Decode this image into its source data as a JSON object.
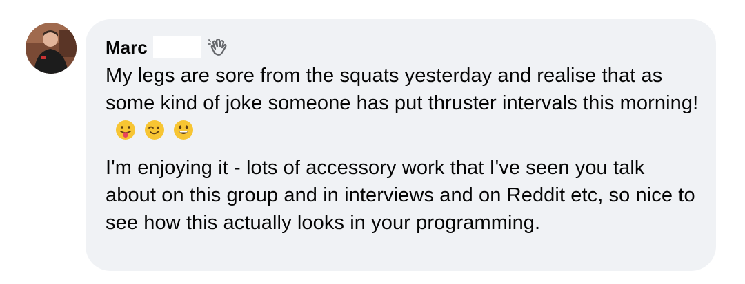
{
  "comment": {
    "author": "Marc",
    "paragraph_1": "My legs are sore from the squats yesterday and realise that as some kind of joke someone has put thruster intervals this morning!",
    "paragraph_1_emojis": [
      "tongue-out-emoji",
      "winking-emoji",
      "grinning-emoji"
    ],
    "paragraph_2": "I'm enjoying it - lots of accessory work that I've seen you talk about on this group and in interviews and on Reddit etc, so nice to see how this actually looks in your programming.",
    "badge_icon": "waving-hand-icon",
    "colors": {
      "bubble_background": "#f0f2f5",
      "text": "#050505",
      "emoji_face": "#f7c533"
    }
  }
}
